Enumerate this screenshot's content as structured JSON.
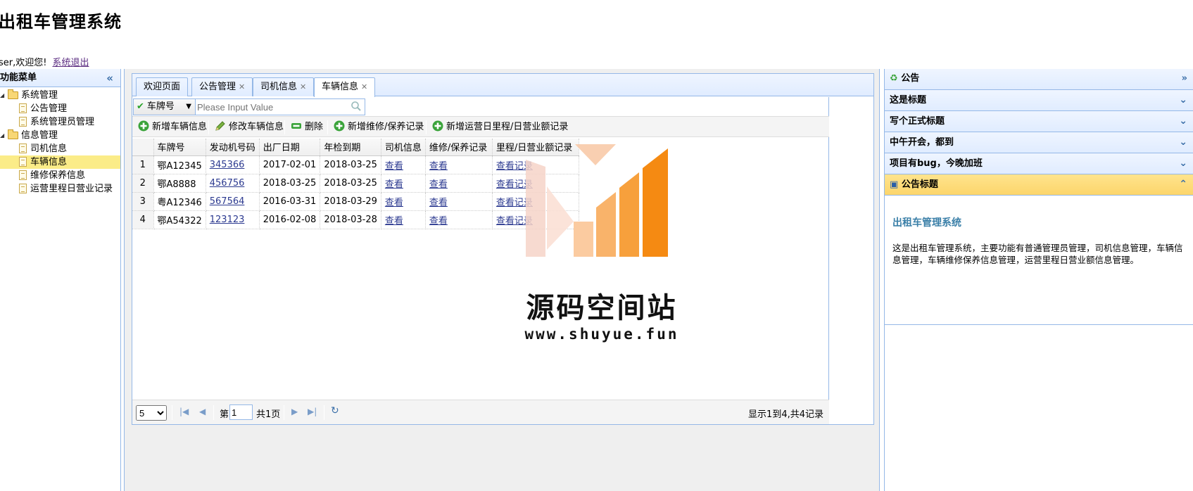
{
  "header": {
    "app_title": "出租车管理系统",
    "welcome": "ser,欢迎您!",
    "logout": "系统退出"
  },
  "left_menu": {
    "title": "功能菜单",
    "groups": [
      {
        "label": "系统管理",
        "items": [
          "公告管理",
          "系统管理员管理"
        ]
      },
      {
        "label": "信息管理",
        "items": [
          "司机信息",
          "车辆信息",
          "维修保养信息",
          "运营里程日营业记录"
        ]
      }
    ],
    "selected": "车辆信息"
  },
  "tabs": [
    {
      "label": "欢迎页面",
      "closable": false
    },
    {
      "label": "公告管理",
      "closable": true
    },
    {
      "label": "司机信息",
      "closable": true
    },
    {
      "label": "车辆信息",
      "closable": true,
      "active": true
    }
  ],
  "search": {
    "field": "车牌号",
    "placeholder": "Please Input Value"
  },
  "toolbar": {
    "add": "新增车辆信息",
    "edit": "修改车辆信息",
    "delete": "删除",
    "add_maint": "新增维修/保养记录",
    "add_mileage": "新增运营日里程/日营业额记录"
  },
  "grid": {
    "columns": [
      "车牌号",
      "发动机号码",
      "出厂日期",
      "年检到期",
      "司机信息",
      "维修/保养记录",
      "里程/日营业额记录"
    ],
    "rows": [
      {
        "no": "1",
        "plate": "鄂A12345",
        "engine": "345366",
        "made": "2017-02-01",
        "inspect": "2018-03-25",
        "driver": "查看",
        "maint": "查看",
        "mileage": "查看记录"
      },
      {
        "no": "2",
        "plate": "鄂A8888",
        "engine": "456756",
        "made": "2018-03-25",
        "inspect": "2018-03-25",
        "driver": "查看",
        "maint": "查看",
        "mileage": "查看记录"
      },
      {
        "no": "3",
        "plate": "粤A12346",
        "engine": "567564",
        "made": "2016-03-31",
        "inspect": "2018-03-29",
        "driver": "查看",
        "maint": "查看",
        "mileage": "查看记录"
      },
      {
        "no": "4",
        "plate": "鄂A54322",
        "engine": "123123",
        "made": "2016-02-08",
        "inspect": "2018-03-28",
        "driver": "查看",
        "maint": "查看",
        "mileage": "查看记录"
      }
    ]
  },
  "pager": {
    "page_size": "5",
    "page_label": "第",
    "page_value": "1",
    "total_pages": "共1页",
    "info": "显示1到4,共4记录"
  },
  "right_panel": {
    "title": "公告",
    "items": [
      "这是标题",
      "写个正式标题",
      "中午开会，都到",
      "项目有bug，今晚加班"
    ],
    "selected_title": "公告标题",
    "notice_heading": "出租车管理系统",
    "notice_text": "这是出租车管理系统，主要功能有普通管理员管理，司机信息管理，车辆信息管理，车辆维修保养信息管理，运营里程日营业额信息管理。"
  },
  "watermark": {
    "text": "源码空间站",
    "url": "www.shuyue.fun"
  },
  "colors": {
    "border": "#95b8e7",
    "header_bg": "#e0ecff",
    "selected": "#fbec88",
    "link": "#2c3a90"
  }
}
